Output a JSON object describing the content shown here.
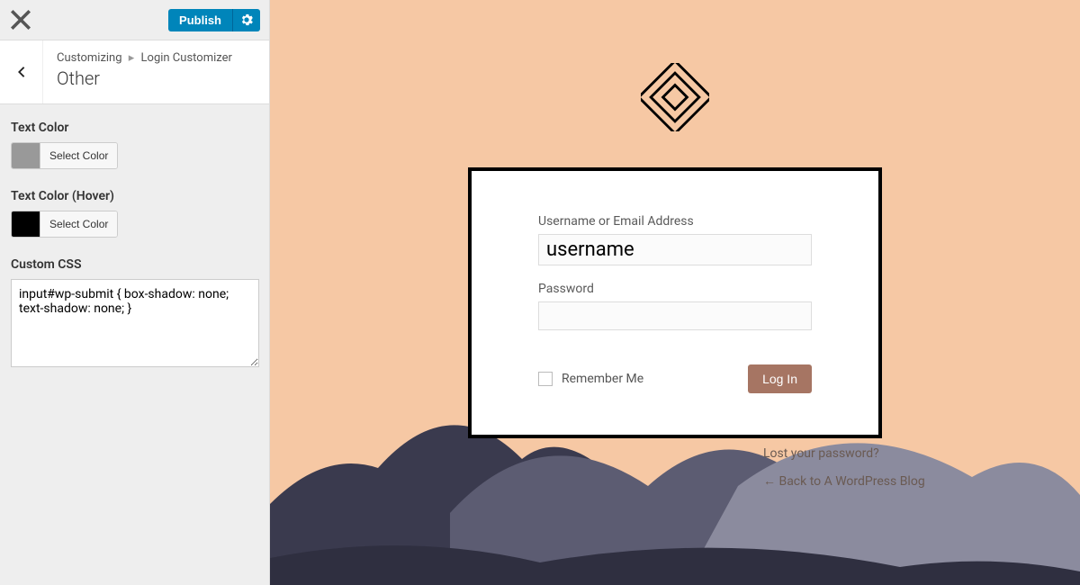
{
  "topbar": {
    "publish_label": "Publish"
  },
  "breadcrumb": {
    "crumb1": "Customizing",
    "crumb2": "Login Customizer",
    "title": "Other"
  },
  "controls": {
    "text_color_label": "Text Color",
    "text_color_hover_label": "Text Color (Hover)",
    "select_color_label": "Select Color",
    "custom_css_label": "Custom CSS",
    "custom_css_value": "input#wp-submit { box-shadow: none; text-shadow: none; }",
    "swatch_text_color": "#999999",
    "swatch_text_hover_color": "#000000"
  },
  "login": {
    "username_label": "Username or Email Address",
    "username_value": "username",
    "password_label": "Password",
    "password_value": "",
    "remember_label": "Remember Me",
    "login_button_label": "Log In"
  },
  "links": {
    "lost_password": "Lost your password?",
    "back_to": "← Back to A WordPress Blog"
  },
  "colors": {
    "accent_button": "#a67563",
    "publish_button": "#0085ba",
    "preview_bg": "#f6c8a4"
  }
}
